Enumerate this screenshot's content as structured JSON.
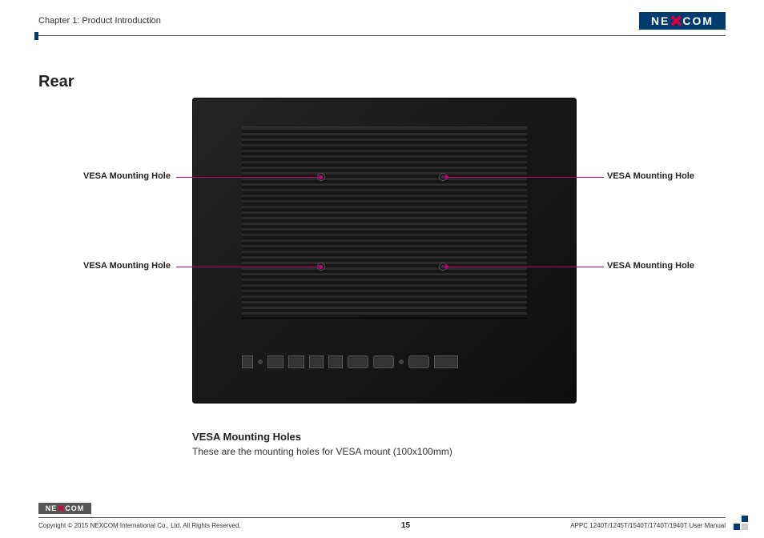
{
  "header": {
    "chapter": "Chapter 1: Product Introduction",
    "brand": "NEXCOM"
  },
  "section": {
    "title": "Rear"
  },
  "callouts": {
    "top_left": "VESA Mounting Hole",
    "top_right": "VESA Mounting Hole",
    "bottom_left": "VESA Mounting Hole",
    "bottom_right": "VESA Mounting Hole"
  },
  "description": {
    "title": "VESA Mounting Holes",
    "text": "These are the mounting holes for VESA mount (100x100mm)"
  },
  "footer": {
    "copyright": "Copyright © 2015 NEXCOM International Co., Ltd. All Rights Reserved.",
    "page_number": "15",
    "doc_ref": "APPC 1240T/1245T/1540T/1740T/1940T User Manual"
  }
}
